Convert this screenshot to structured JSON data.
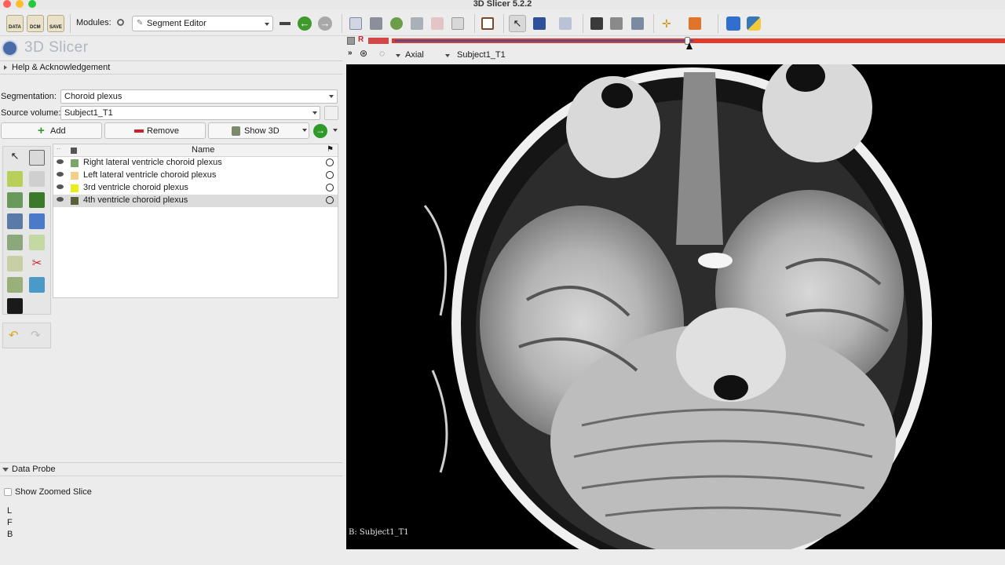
{
  "window": {
    "title": "3D Slicer 5.2.2"
  },
  "toolbar": {
    "data_label": "DATA",
    "dcm_label": "DCM",
    "save_label": "SAVE",
    "modules_label": "Modules:",
    "module_value": "Segment Editor",
    "icons": [
      "load-data-icon",
      "dicom-icon",
      "save-icon",
      "search-icon",
      "module-history-icon",
      "back-icon",
      "forward-icon",
      "layout-icon",
      "crosshair-icon",
      "python-icon"
    ]
  },
  "app": {
    "logo_text": "3D Slicer"
  },
  "sections": {
    "help": "Help & Acknowledgement",
    "data_probe": "Data Probe"
  },
  "segmentation": {
    "label": "Segmentation:",
    "value": "Choroid plexus",
    "source_label": "Source volume:",
    "source_value": "Subject1_T1"
  },
  "buttons": {
    "add": "Add",
    "remove": "Remove",
    "show3d": "Show 3D"
  },
  "table": {
    "header_name": "Name",
    "rows": [
      {
        "name": "Right lateral ventricle choroid plexus",
        "color": "#7aa66a"
      },
      {
        "name": "Left lateral ventricle choroid plexus",
        "color": "#f1d08c"
      },
      {
        "name": "3rd ventricle choroid plexus",
        "color": "#e8ef17"
      },
      {
        "name": "4th ventricle choroid plexus",
        "color": "#5b5f3a"
      }
    ]
  },
  "probe": {
    "show_zoomed": "Show Zoomed Slice",
    "l": "L",
    "f": "F",
    "b": "B"
  },
  "viewer": {
    "view_letter": "R",
    "orientation": "Axial",
    "volume": "Subject1_T1",
    "overlay": "B: Subject1_T1"
  }
}
